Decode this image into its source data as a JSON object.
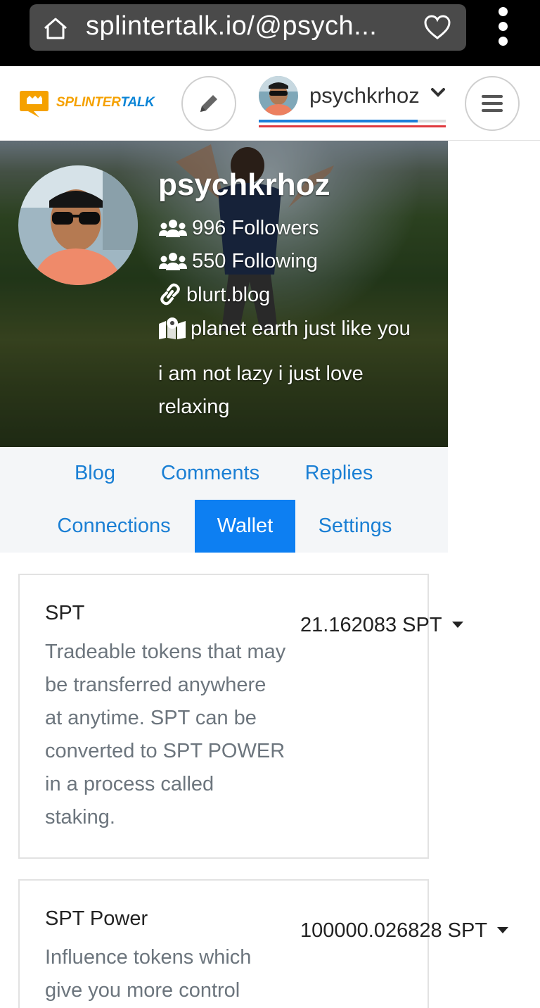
{
  "browser": {
    "url": "splintertalk.io/@psych...",
    "icons": [
      "home-icon",
      "heart-icon",
      "kebab-menu-icon"
    ]
  },
  "header": {
    "logo_text_a": "SPLINTER",
    "logo_text_b": "TALK",
    "username": "psychkrhoz",
    "accent_blue": "#1e7fd9",
    "accent_red": "#e0393e"
  },
  "profile": {
    "name": "psychkrhoz",
    "followers": "996 Followers",
    "following": "550 Following",
    "website": "blurt.blog",
    "location": "planet earth just like you",
    "bio": "i am not lazy i just love relaxing"
  },
  "tabs": [
    {
      "label": "Blog",
      "active": false
    },
    {
      "label": "Comments",
      "active": false
    },
    {
      "label": "Replies",
      "active": false
    },
    {
      "label": "Connections",
      "active": false
    },
    {
      "label": "Wallet",
      "active": true
    },
    {
      "label": "Settings",
      "active": false
    }
  ],
  "wallet": [
    {
      "title": "SPT",
      "description": "Tradeable tokens that may be transferred anywhere at anytime. SPT can be converted to SPT POWER in a process called staking.",
      "value": "21.162083 SPT"
    },
    {
      "title": "SPT Power",
      "description": "Influence tokens which give you more control",
      "value": "100000.026828 SPT"
    }
  ]
}
